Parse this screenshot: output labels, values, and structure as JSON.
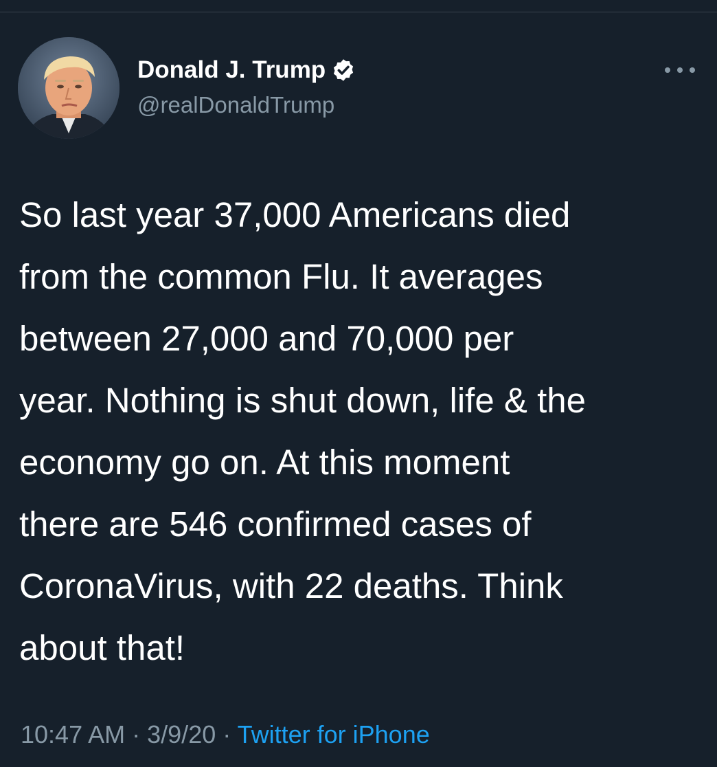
{
  "tweet": {
    "author": {
      "display_name": "Donald J. Trump",
      "handle": "@realDonaldTrump",
      "verified": true,
      "avatar_icon": "profile-photo"
    },
    "text_lines": [
      "So last year 37,000 Americans died",
      "from the common Flu. It averages",
      "between 27,000 and 70,000 per",
      "year. Nothing is shut down, life & the",
      "economy go on. At this moment",
      "there are 546 confirmed cases of",
      "CoronaVirus, with 22 deaths. Think",
      "about that!"
    ],
    "time": "10:47 AM",
    "date": "3/9/20",
    "separator": "·",
    "source": "Twitter for iPhone",
    "more_icon": "more-horizontal-icon"
  },
  "colors": {
    "background": "#16202b",
    "primary_text": "#ffffff",
    "secondary_text": "#8899a6",
    "accent": "#1da1f2",
    "divider": "#38444d"
  }
}
